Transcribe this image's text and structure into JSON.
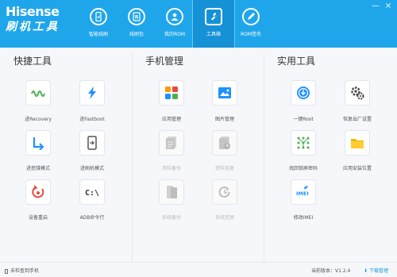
{
  "brand": {
    "name": "Hisense",
    "subtitle": "刷机工具"
  },
  "window_controls": [
    "—",
    "×"
  ],
  "nav": [
    {
      "label": "智能线刷",
      "icon": "phone-sync-icon"
    },
    {
      "label": "线刷包",
      "icon": "package-icon"
    },
    {
      "label": "我的ROM",
      "icon": "user-icon"
    },
    {
      "label": "工具箱",
      "icon": "wrench-icon",
      "active": true
    },
    {
      "label": "ROM签名",
      "icon": "pen-icon"
    }
  ],
  "sections": [
    {
      "title": "快捷工具",
      "items": [
        {
          "label": "进Recovery",
          "icon": "waveform-icon",
          "color": "#4caf50",
          "enabled": true
        },
        {
          "label": "进Fastboot",
          "icon": "lightning-icon",
          "color": "#1e90ff",
          "enabled": true
        },
        {
          "label": "进挖煤模式",
          "icon": "arrow-down-right-icon",
          "color": "#1e90ff",
          "enabled": true
        },
        {
          "label": "进刷机模式",
          "icon": "device-arrow-icon",
          "color": "#555555",
          "enabled": true
        },
        {
          "label": "设备重启",
          "icon": "restart-icon",
          "color": "#e64a3a",
          "enabled": true
        },
        {
          "label": "ADB命令行",
          "icon": "terminal-icon",
          "color": "#333333",
          "enabled": true
        }
      ]
    },
    {
      "title": "手机管理",
      "items": [
        {
          "label": "应用管理",
          "icon": "apps-grid-icon",
          "color": "#ff9800",
          "enabled": true
        },
        {
          "label": "图片管理",
          "icon": "picture-icon",
          "color": "#1e90ff",
          "enabled": true
        },
        {
          "label": "资料备份",
          "icon": "doc-backup-icon",
          "color": "#bbbbbb",
          "enabled": false
        },
        {
          "label": "资料恢复",
          "icon": "doc-restore-icon",
          "color": "#bbbbbb",
          "enabled": false
        },
        {
          "label": "系统备份",
          "icon": "system-backup-icon",
          "color": "#bbbbbb",
          "enabled": false
        },
        {
          "label": "系统还原",
          "icon": "system-restore-icon",
          "color": "#bbbbbb",
          "enabled": false
        }
      ]
    },
    {
      "title": "实用工具",
      "items": [
        {
          "label": "一键Root",
          "icon": "root-icon",
          "color": "#1e90ff",
          "enabled": true
        },
        {
          "label": "恢复出厂设置",
          "icon": "gear-icon",
          "color": "#444444",
          "enabled": true
        },
        {
          "label": "找回锁屏密码",
          "icon": "pattern-lock-icon",
          "color": "#4caf50",
          "enabled": true
        },
        {
          "label": "应用安装位置",
          "icon": "folder-icon",
          "color": "#f5b800",
          "enabled": true
        },
        {
          "label": "修改IMEI",
          "icon": "imei-pen-icon",
          "color": "#1e90ff",
          "enabled": true
        }
      ]
    }
  ],
  "footer": {
    "status": "未检查到手机",
    "version_label": "当前版本：V1.2.4",
    "download_label": "下载管理"
  }
}
